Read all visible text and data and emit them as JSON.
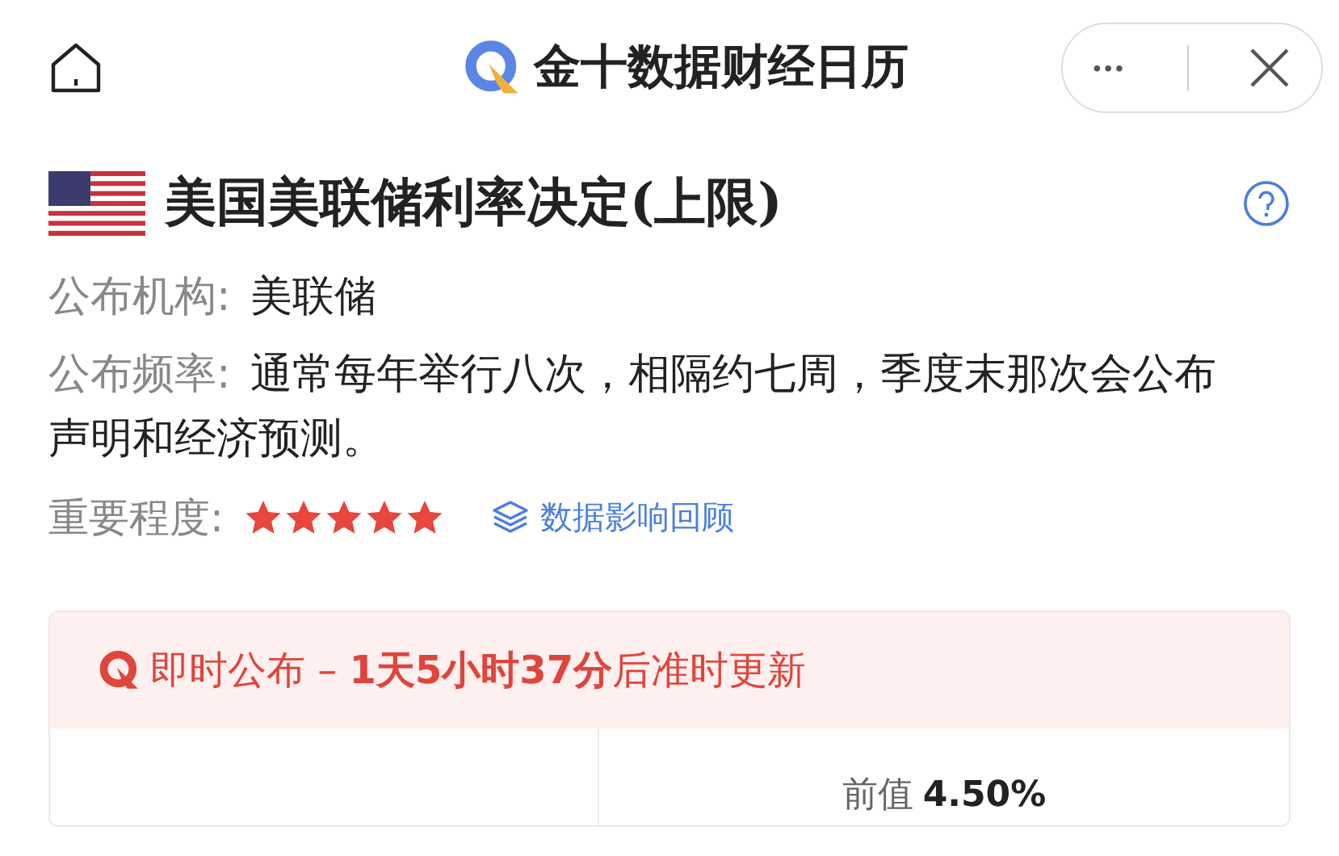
{
  "header": {
    "title": "金十数据财经日历",
    "menu_glyph": "•••"
  },
  "event": {
    "title": "美国美联储利率决定(上限)",
    "fields": [
      {
        "label": "公布机构:",
        "value": "美联储"
      },
      {
        "label": "公布频率:",
        "value": "通常每年举行八次，相隔约七周，季度末那次会公布声明和经济预测。"
      }
    ],
    "importance": {
      "label": "重要程度:",
      "stars": 5
    },
    "review_link": "数据影响回顾"
  },
  "release": {
    "notice": "即时公布 – **1天5小时37分**后准时更新",
    "previous": {
      "label": "前值",
      "value": "4.50%"
    }
  }
}
